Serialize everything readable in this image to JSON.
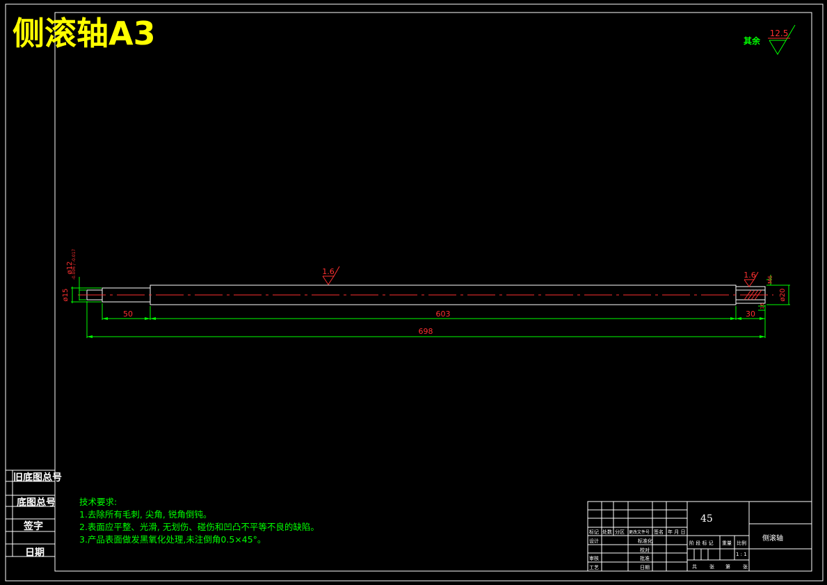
{
  "drawing": {
    "title": "侧滚轴A3",
    "roughness_note": "其余",
    "roughness_default": "12.5",
    "roughness_mid": "1.6",
    "roughness_right": "1.6",
    "dims": {
      "d_left": "ø15",
      "d_fit": "ø12",
      "d_fit_tol": "-0.006 / -0.017",
      "d_right": "ø20",
      "small_w": "M6",
      "small_h": "16",
      "len_left": "50",
      "len_mid": "603",
      "len_right": "30",
      "len_total": "698"
    }
  },
  "side_labels": [
    "旧底图总号",
    "底图总号",
    "签字",
    "日期"
  ],
  "requirements": {
    "heading": "技术要求:",
    "items": [
      "1.去除所有毛刺, 尖角, 锐角倒钝。",
      "2.表面应平整、光滑, 无划伤、碰伤和凹凸不平等不良的缺陷。",
      "3.产品表面做发黑氧化处理,未注倒角0.5×45°。"
    ]
  },
  "title_block": {
    "material": "45",
    "part_name": "侧滚轴",
    "header_row": [
      "标记",
      "处数",
      "分区",
      "更改文件号",
      "签名",
      "年 月 日"
    ],
    "row_design": [
      "设计",
      "",
      "标准化"
    ],
    "row_check": [
      "审核",
      "",
      "批准"
    ],
    "row_craft": [
      "工艺",
      "",
      "日期"
    ],
    "row_mid": [
      "",
      "",
      "校对"
    ],
    "stage_labels": [
      "阶 段 标 记",
      "重量",
      "比例"
    ],
    "scale": "1 : 1",
    "sheet_labels": [
      "共",
      "张",
      "第",
      "张"
    ]
  }
}
